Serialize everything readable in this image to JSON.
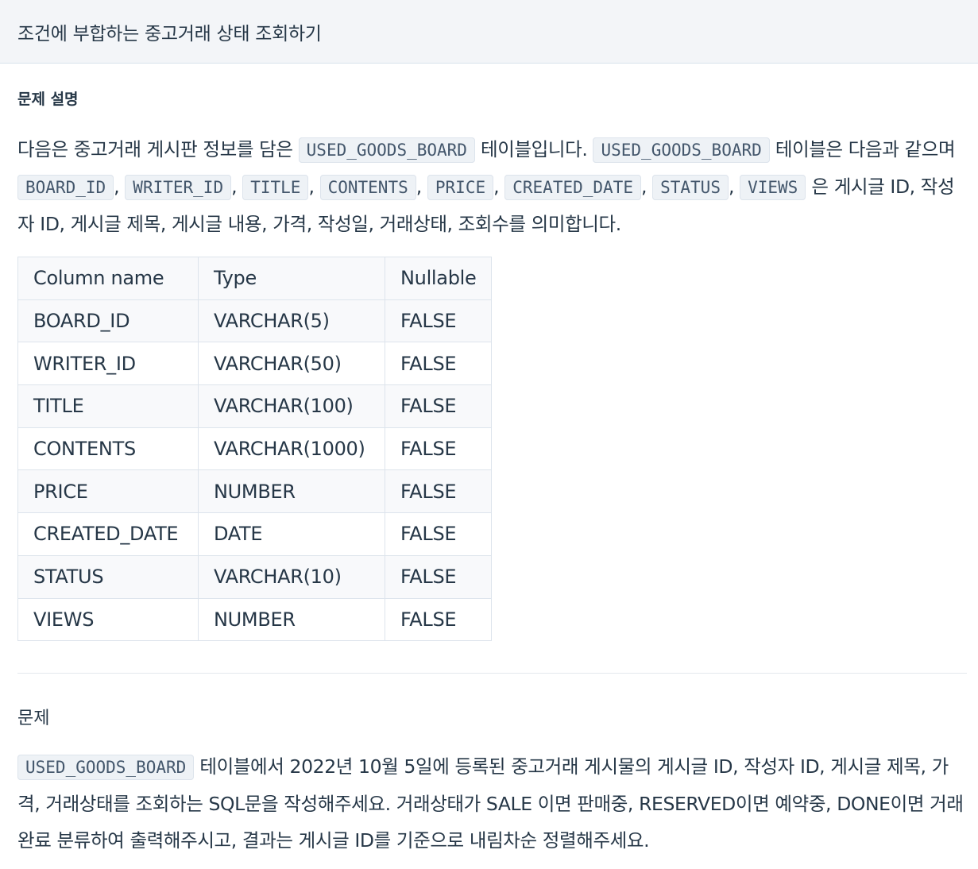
{
  "header": {
    "title": "조건에 부합하는 중고거래 상태 조회하기"
  },
  "description": {
    "heading": "문제 설명",
    "p1_a": "다음은 중고거래 게시판 정보를 담은 ",
    "p1_code1": "USED_GOODS_BOARD",
    "p1_b": " 테이블입니다. ",
    "p1_code2": "USED_GOODS_BOARD",
    "p1_c": " 테이블은 다음과 같으며 ",
    "columns_inline": [
      "BOARD_ID",
      "WRITER_ID",
      "TITLE",
      "CONTENTS",
      "PRICE",
      "CREATED_DATE",
      "STATUS",
      "VIEWS"
    ],
    "p1_d": " 은 게시글 ID, 작성자 ID, 게시글 제목, 게시글 내용, 가격, 작성일, 거래상태, 조회수를 의미합니다."
  },
  "schema_table": {
    "headers": [
      "Column name",
      "Type",
      "Nullable"
    ],
    "rows": [
      [
        "BOARD_ID",
        "VARCHAR(5)",
        "FALSE"
      ],
      [
        "WRITER_ID",
        "VARCHAR(50)",
        "FALSE"
      ],
      [
        "TITLE",
        "VARCHAR(100)",
        "FALSE"
      ],
      [
        "CONTENTS",
        "VARCHAR(1000)",
        "FALSE"
      ],
      [
        "PRICE",
        "NUMBER",
        "FALSE"
      ],
      [
        "CREATED_DATE",
        "DATE",
        "FALSE"
      ],
      [
        "STATUS",
        "VARCHAR(10)",
        "FALSE"
      ],
      [
        "VIEWS",
        "NUMBER",
        "FALSE"
      ]
    ]
  },
  "problem": {
    "heading": "문제",
    "code": "USED_GOODS_BOARD",
    "text": " 테이블에서 2022년 10월 5일에 등록된 중고거래 게시물의 게시글 ID, 작성자 ID, 게시글 제목, 가격, 거래상태를 조회하는 SQL문을 작성해주세요. 거래상태가 SALE 이면 판매중, RESERVED이면 예약중, DONE이면 거래완료 분류하여 출력해주시고, 결과는 게시글 ID를 기준으로 내림차순 정렬해주세요."
  }
}
